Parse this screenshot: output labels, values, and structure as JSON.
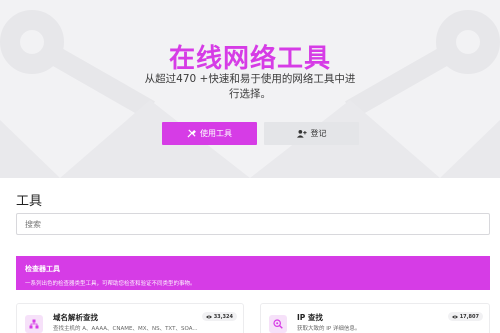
{
  "hero": {
    "title": "在线网络工具",
    "subtitle": "从超过470 +快速和易于使用的网络工具中进行选择。",
    "primary_button": "使用工具",
    "secondary_button": "登记"
  },
  "tools_section": {
    "title": "工具",
    "search_placeholder": "搜索"
  },
  "banner": {
    "title": "检查器工具",
    "description": "一系列出色的检查器类型工具，可帮助您检查和验证不同类型的事物。"
  },
  "cards": [
    {
      "title": "域名解析查找",
      "description": "查找主机的 A、AAAA、CNAME、MX、NS、TXT、SOA...",
      "views": "33,324",
      "icon": "network-icon"
    },
    {
      "title": "IP 查找",
      "description": "获取大致的 IP 详细信息。",
      "views": "17,807",
      "icon": "search-location-icon"
    }
  ],
  "colors": {
    "accent": "#d63ce6",
    "hero_bg": "#f2f2f4",
    "secondary_btn": "#e4e5e8"
  }
}
